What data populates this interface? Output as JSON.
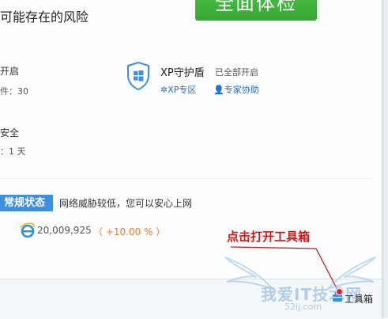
{
  "header": {
    "risk_text": "可能存在的风险",
    "check_button_label": "全面体检"
  },
  "protection_left": {
    "status_on": "开启",
    "detail_count": "件：30"
  },
  "xp_shield": {
    "title": "XP守护盾",
    "status": "已全部开启",
    "link_xp_zone": "XP专区",
    "link_expert_help": "专家协助"
  },
  "safety_left": {
    "status": "安全",
    "days": "：1 天"
  },
  "network_status": {
    "badge": "常规状态",
    "text": "网络威胁较低，您可以安心上网",
    "count": "20,009,925",
    "change": "（ +10.00 % ）"
  },
  "annotation": {
    "text": "点击打开工具箱"
  },
  "toolbox": {
    "label": "工具箱"
  },
  "watermark": {
    "text": "我爱IT技术网",
    "sub": "52ij.com"
  },
  "colors": {
    "accent_blue": "#3f8fe0",
    "green_button": "#3cb43a",
    "link_blue": "#2a6ebb",
    "annotation_red": "#d81414",
    "change_orange": "#f07a2e"
  },
  "icons": {
    "shield": "windows-shield-icon",
    "ie": "ie-icon",
    "toolbox": "toolbox-icon"
  }
}
